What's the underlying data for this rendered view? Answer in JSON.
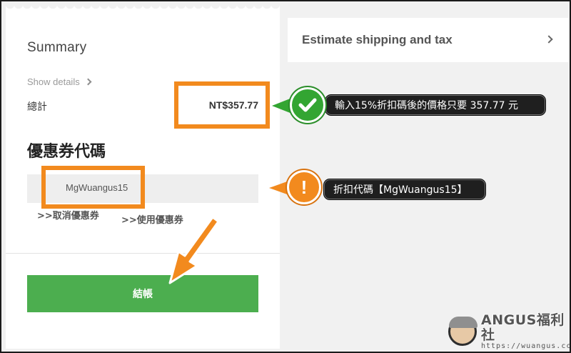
{
  "summary": {
    "title": "Summary",
    "show_details": "Show details",
    "total_label": "總計",
    "total_value": "NT$357.77"
  },
  "coupon": {
    "heading": "優惠券代碼",
    "input_value": "MgWuangus15",
    "cancel_label": ">>取消優惠券",
    "apply_label": ">>使用優惠券"
  },
  "checkout": {
    "button_label": "結帳",
    "button_color": "#4cae4f"
  },
  "shipping": {
    "label": "Estimate shipping and tax"
  },
  "annotations": {
    "price_note": "輸入15%折扣碼後的價格只要 357.77 元",
    "code_note": "折扣代碼【MgWuangus15】",
    "highlight_color": "#f28a1e",
    "check_color": "#33a532",
    "arrow_color": "#f28a1e"
  },
  "watermark": {
    "brand": "ANGUS福利社",
    "url": "https://wuangus.cc"
  }
}
